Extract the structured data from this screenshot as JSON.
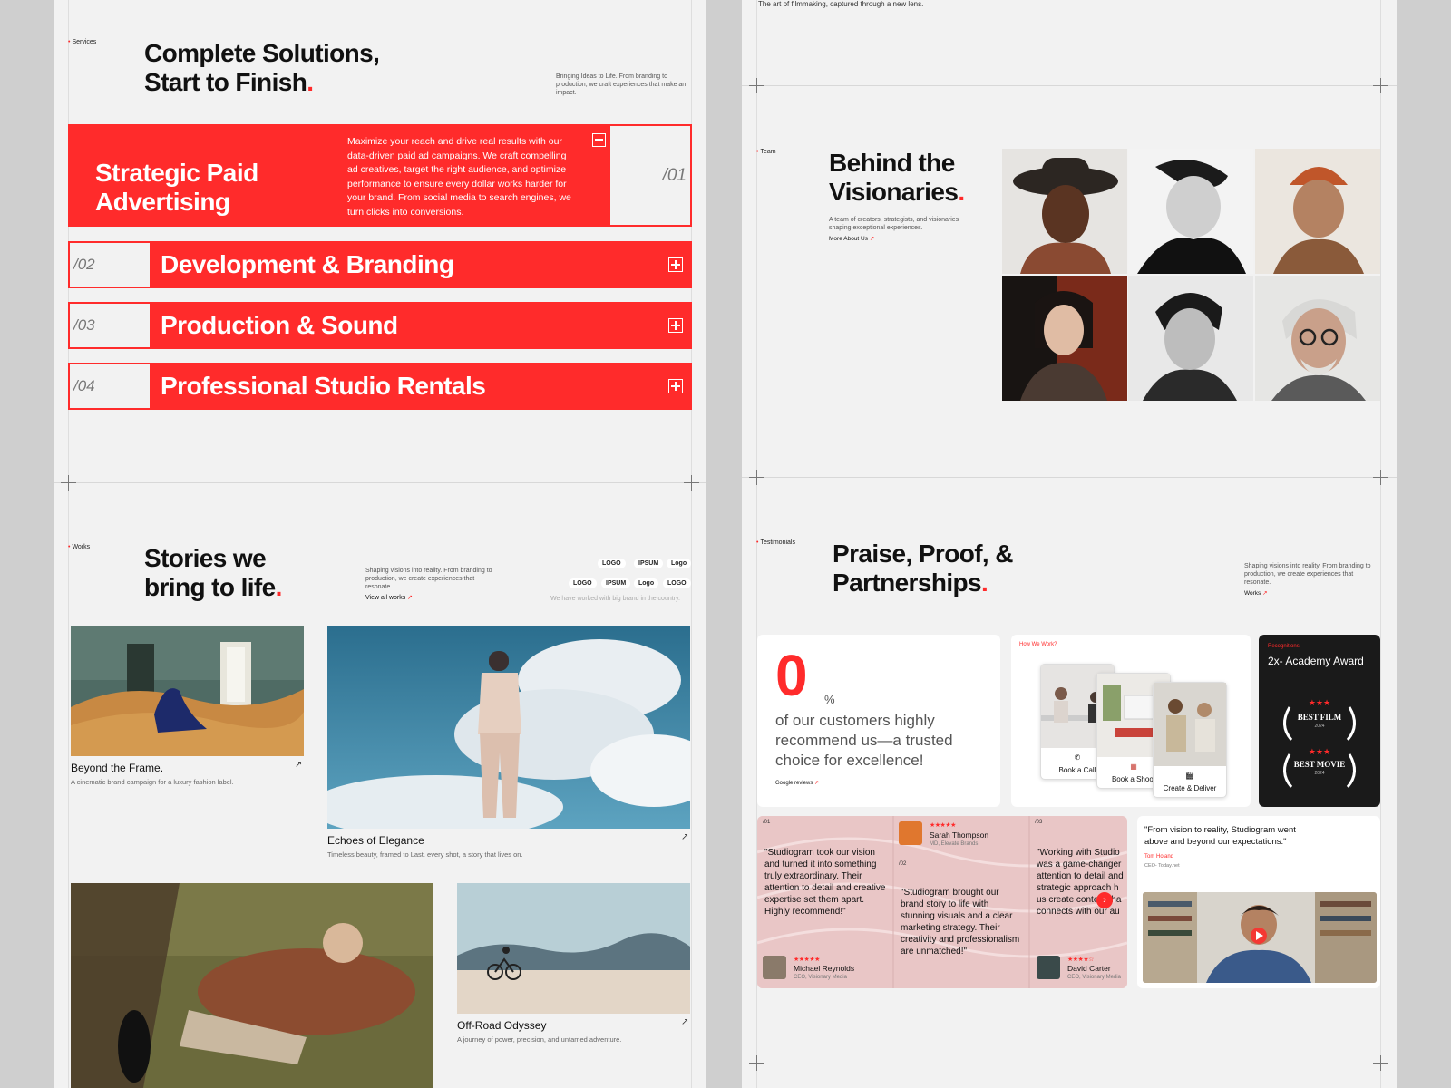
{
  "services": {
    "label": "Services",
    "title_line1": "Complete Solutions,",
    "title_line2": "Start to Finish",
    "title_dot": ".",
    "intro": "Bringing Ideas to Life. From branding to production, we craft experiences that make an impact.",
    "open_item": {
      "title_line1": "Strategic Paid",
      "title_line2": "Advertising",
      "description": "Maximize your reach and drive real results with our data-driven paid ad campaigns. We craft compelling ad creatives, target the right audience, and optimize performance to ensure every dollar works harder for your brand. From social media to search engines, we turn clicks into conversions.",
      "number": "/01"
    },
    "items": [
      {
        "number": "/02",
        "title": "Development & Branding"
      },
      {
        "number": "/03",
        "title": "Production & Sound"
      },
      {
        "number": "/04",
        "title": "Professional Studio Rentals"
      }
    ]
  },
  "works": {
    "label": "Works",
    "title_line1": "Stories we",
    "title_line2": "bring to life",
    "title_dot": ".",
    "intro": "Shaping visions into reality. From branding to production, we create experiences that resonate.",
    "view_all": "View all works",
    "logos": [
      "LOGO",
      "IPSUM",
      "Logo",
      "LOGO",
      "IPSUM",
      "Logo",
      "LOGO"
    ],
    "brands_note": "We have worked with big brand in the country.",
    "items": [
      {
        "title": "Beyond the Frame.",
        "subtitle": "A cinematic brand campaign for a luxury fashion label."
      },
      {
        "title": "Echoes of Elegance",
        "subtitle": "Timeless beauty, framed to Last. every shot, a story that lives on."
      },
      {
        "title": "",
        "subtitle": ""
      },
      {
        "title": "Off-Road Odyssey",
        "subtitle": "A journey of power, precision, and untamed adventure."
      }
    ]
  },
  "hero_caption": "The art of filmmaking, captured through a new lens.",
  "team": {
    "label": "Team",
    "title_line1": "Behind the",
    "title_line2": "Visionaries",
    "title_dot": ".",
    "intro": "A team of creators, strategists, and visionaries shaping exceptional experiences.",
    "more_link": "More About Us"
  },
  "testimonials": {
    "label": "Testimonials",
    "title_line1": "Praise, Proof, &",
    "title_line2": "Partnerships",
    "title_dot": ".",
    "intro": "Shaping visions into reality. From branding to production, we create experiences that resonate.",
    "works_link": "Works",
    "stat": {
      "value": "0",
      "unit": "%",
      "text": "of our customers highly recommend us—a trusted choice for excellence!",
      "link": "Google reviews"
    },
    "how_we_work": {
      "label": "How We Work?",
      "steps": [
        "Book a Call",
        "Book a Shoot",
        "Create & Deliver"
      ]
    },
    "recognitions": {
      "label": "Recognitions",
      "title": "2x- Academy Award",
      "badges": [
        "BEST FILM",
        "BEST MOVIE"
      ],
      "badge_year": "2024"
    },
    "quotes": [
      {
        "number": "/01",
        "text": "\"Studiogram took our vision and turned it into something truly extraordinary. Their attention to detail and creative expertise set them apart. Highly recommend!\"",
        "name": "Michael Reynolds",
        "role": "CEO, Visionary Media",
        "stars": "★★★★★"
      },
      {
        "number": "/02",
        "text": "\"Studiogram brought our brand story to life with stunning visuals and a clear marketing strategy. Their creativity and professionalism are unmatched!\"",
        "name": "Sarah Thompson",
        "role": "MD, Elevate Brands",
        "stars": "★★★★★"
      },
      {
        "number": "/03",
        "text": "\"Working with Studio was a game-changer attention to detail and strategic approach h us create content tha connects with our au",
        "name": "David Carter",
        "role": "CEO, Visionary Media",
        "stars": "★★★★☆"
      }
    ],
    "video_card": {
      "quote": "\"From vision to reality, Studiogram went above and beyond our expectations.\"",
      "name": "Tom Holand",
      "role": "CEO- Today.net"
    }
  },
  "colors": {
    "accent": "#ff2b2b",
    "background": "#f2f2f2",
    "dark_card": "#1a1a1a"
  }
}
